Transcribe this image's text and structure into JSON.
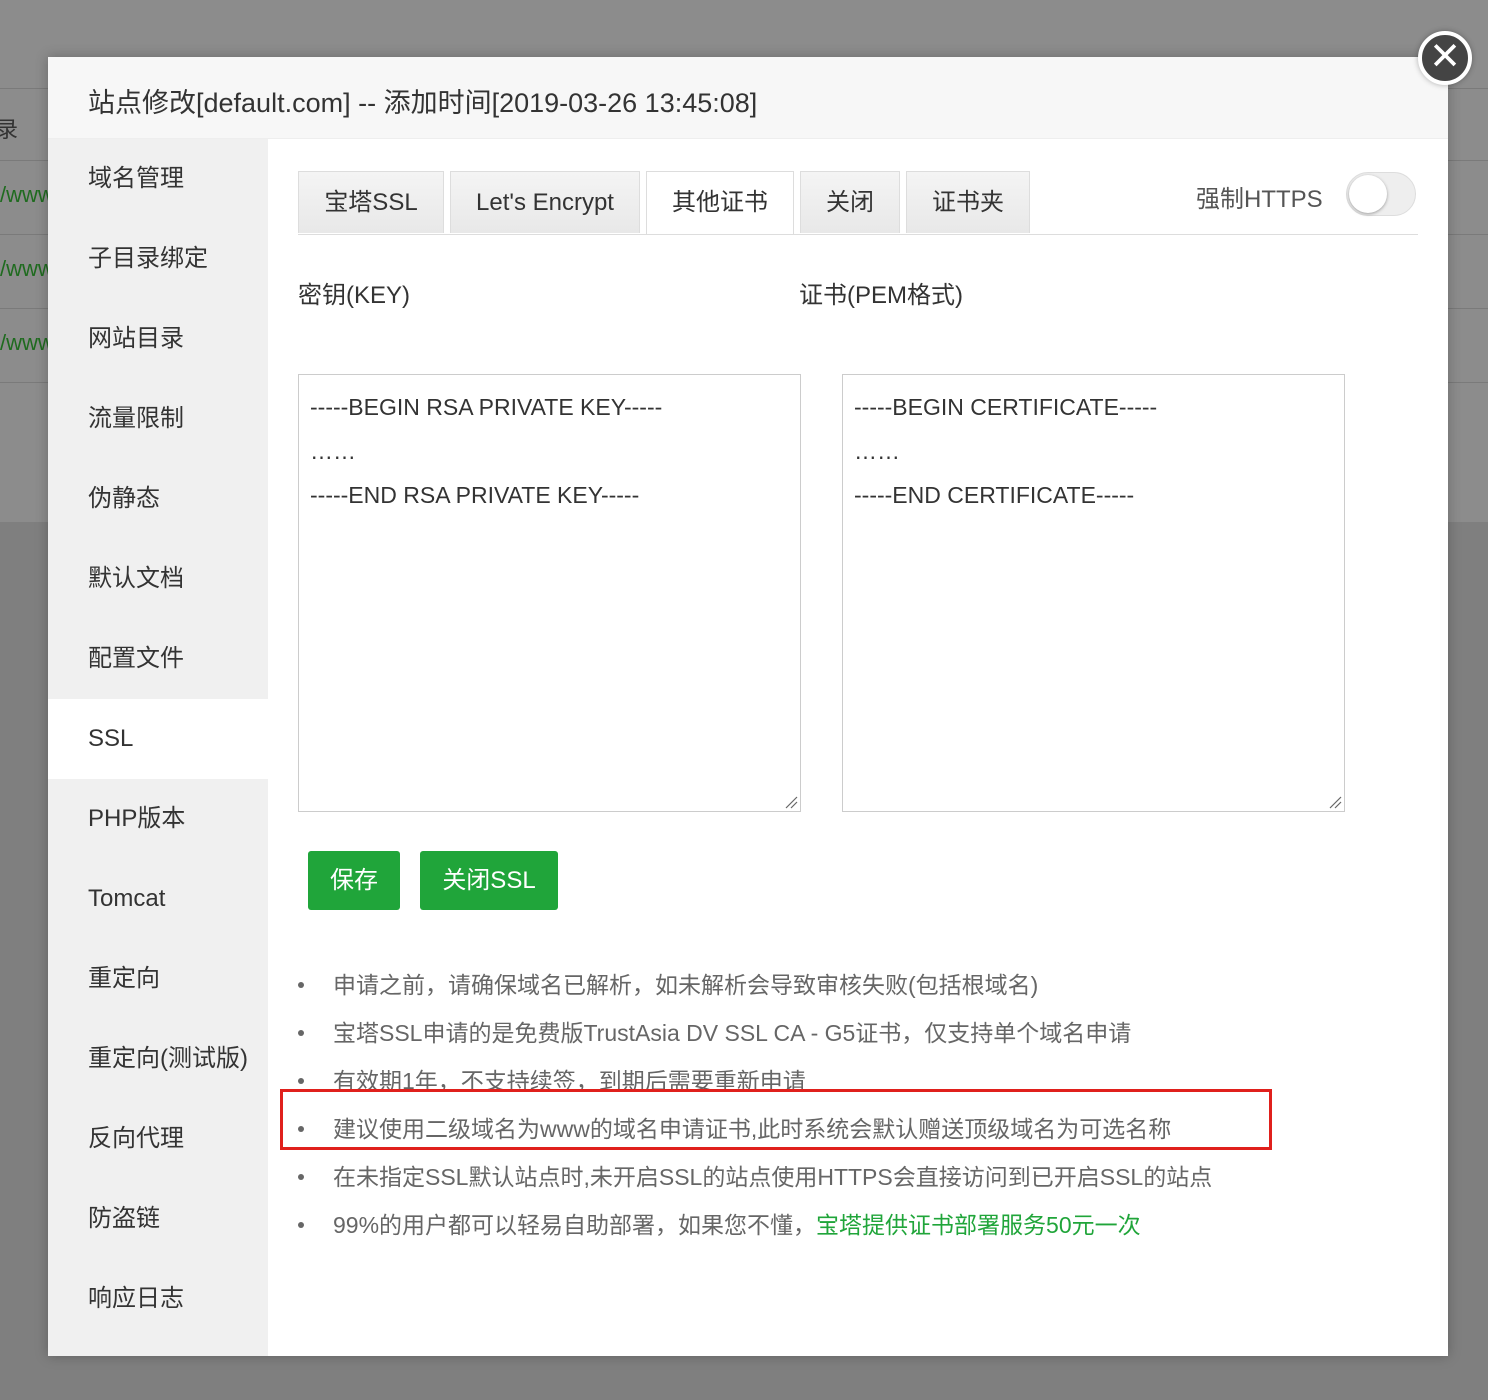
{
  "background": {
    "partial_label": "录",
    "links": [
      "/www",
      "/www",
      "/www"
    ]
  },
  "modal": {
    "title": "站点修改[default.com] -- 添加时间[2019-03-26 13:45:08]",
    "close_symbol": "✕"
  },
  "sidebar": {
    "items": [
      {
        "label": "域名管理"
      },
      {
        "label": "子目录绑定"
      },
      {
        "label": "网站目录"
      },
      {
        "label": "流量限制"
      },
      {
        "label": "伪静态"
      },
      {
        "label": "默认文档"
      },
      {
        "label": "配置文件"
      },
      {
        "label": "SSL"
      },
      {
        "label": "PHP版本"
      },
      {
        "label": "Tomcat"
      },
      {
        "label": "重定向"
      },
      {
        "label": "重定向(测试版)"
      },
      {
        "label": "反向代理"
      },
      {
        "label": "防盗链"
      },
      {
        "label": "响应日志"
      }
    ],
    "active": "SSL"
  },
  "tabs": [
    {
      "label": "宝塔SSL"
    },
    {
      "label": "Let's Encrypt"
    },
    {
      "label": "其他证书"
    },
    {
      "label": "关闭"
    },
    {
      "label": "证书夹"
    }
  ],
  "active_tab": "其他证书",
  "force_https": {
    "label": "强制HTTPS",
    "enabled": false
  },
  "key_field": {
    "label": "密钥(KEY)",
    "lines": [
      "-----BEGIN RSA PRIVATE KEY-----",
      "……",
      "-----END RSA PRIVATE KEY-----"
    ]
  },
  "cert_field": {
    "label": "证书(PEM格式)",
    "lines": [
      "-----BEGIN CERTIFICATE-----",
      "……",
      "-----END CERTIFICATE-----"
    ]
  },
  "buttons": {
    "save": "保存",
    "close_ssl": "关闭SSL"
  },
  "tips": {
    "items": [
      "申请之前，请确保域名已解析，如未解析会导致审核失败(包括根域名)",
      "宝塔SSL申请的是免费版TrustAsia DV SSL CA - G5证书，仅支持单个域名申请",
      "有效期1年，不支持续签，到期后需要重新申请",
      "建议使用二级域名为www的域名申请证书,此时系统会默认赠送顶级域名为可选名称",
      "在未指定SSL默认站点时,未开启SSL的站点使用HTTPS会直接访问到已开启SSL的站点"
    ],
    "last_text": "99%的用户都可以轻易自助部署，如果您不懂，",
    "last_link": "宝塔提供证书部署服务50元一次"
  },
  "colors": {
    "accent": "#20a53a",
    "highlight": "#e0201c"
  }
}
